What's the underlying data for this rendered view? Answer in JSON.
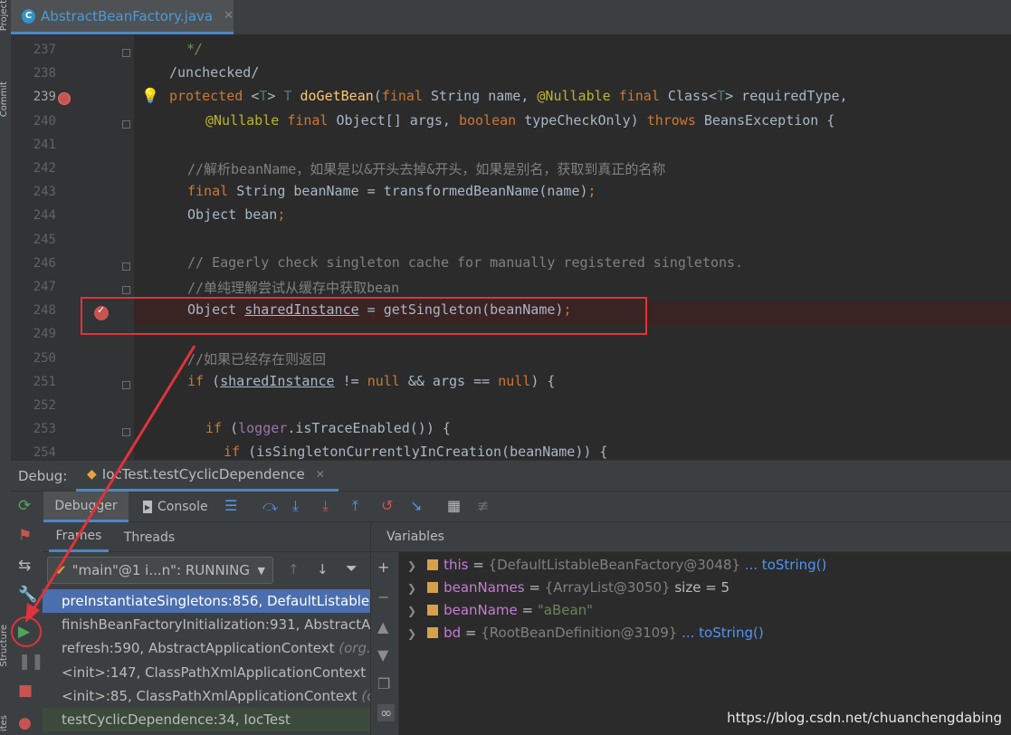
{
  "editor_tab": {
    "icon": "C",
    "file_name": "AbstractBeanFactory.java",
    "close": "✕"
  },
  "left_strip": {
    "labels": [
      "Project",
      "Commit",
      "Structure",
      "ites"
    ]
  },
  "code_lines": [
    {
      "num": "237",
      "segments": [
        {
          "t": " */",
          "c": "doc"
        }
      ],
      "indent": 1
    },
    {
      "num": "238",
      "segments": [
        {
          "t": "/unchecked/",
          "c": "plain"
        }
      ],
      "indent": 0
    },
    {
      "num": "239",
      "segments": [
        {
          "t": "protected ",
          "c": "kw"
        },
        {
          "t": "<",
          "c": "plain"
        },
        {
          "t": "T",
          "c": "tp"
        },
        {
          "t": "> ",
          "c": "plain"
        },
        {
          "t": "T ",
          "c": "tp"
        },
        {
          "t": "doGetBean",
          "c": "fn"
        },
        {
          "t": "(",
          "c": "plain"
        },
        {
          "t": "final ",
          "c": "kw"
        },
        {
          "t": "String name, ",
          "c": "plain"
        },
        {
          "t": "@Nullable ",
          "c": "ann"
        },
        {
          "t": "final ",
          "c": "kw"
        },
        {
          "t": "Class<",
          "c": "plain"
        },
        {
          "t": "T",
          "c": "tp"
        },
        {
          "t": "> requiredType,",
          "c": "plain"
        }
      ],
      "indent": 0
    },
    {
      "num": "240",
      "segments": [
        {
          "t": "@Nullable ",
          "c": "ann"
        },
        {
          "t": "final ",
          "c": "kw"
        },
        {
          "t": "Object[] args, ",
          "c": "plain"
        },
        {
          "t": "boolean ",
          "c": "kw"
        },
        {
          "t": "typeCheckOnly) ",
          "c": "plain"
        },
        {
          "t": "throws ",
          "c": "kw"
        },
        {
          "t": "BeansException {",
          "c": "plain"
        }
      ],
      "indent": 4
    },
    {
      "num": "241",
      "segments": [],
      "indent": 0
    },
    {
      "num": "242",
      "segments": [
        {
          "t": "//解析beanName，如果是以&开头去掉&开头，如果是别名，获取到真正的名称",
          "c": "cm"
        }
      ],
      "indent": 2
    },
    {
      "num": "243",
      "segments": [
        {
          "t": "final ",
          "c": "kw"
        },
        {
          "t": "String beanName = transformedBeanName(name)",
          "c": "plain"
        },
        {
          "t": ";",
          "c": "kw"
        }
      ],
      "indent": 2
    },
    {
      "num": "244",
      "segments": [
        {
          "t": "Object bean",
          "c": "plain"
        },
        {
          "t": ";",
          "c": "kw"
        }
      ],
      "indent": 2
    },
    {
      "num": "245",
      "segments": [],
      "indent": 0
    },
    {
      "num": "246",
      "segments": [
        {
          "t": "// Eagerly check singleton cache for manually registered singletons.",
          "c": "cm"
        }
      ],
      "indent": 2
    },
    {
      "num": "247",
      "segments": [
        {
          "t": "//单纯理解尝试从缓存中获取bean",
          "c": "cm"
        }
      ],
      "indent": 2
    },
    {
      "num": "248",
      "segments": [
        {
          "t": "Object ",
          "c": "plain"
        },
        {
          "t": "sharedInstance",
          "c": "ul"
        },
        {
          "t": " = getSingleton(beanName)",
          "c": "plain"
        },
        {
          "t": ";",
          "c": "kw"
        }
      ],
      "indent": 2
    },
    {
      "num": "249",
      "segments": [],
      "indent": 0
    },
    {
      "num": "250",
      "segments": [
        {
          "t": "//如果已经存在则返回",
          "c": "cm"
        }
      ],
      "indent": 2
    },
    {
      "num": "251",
      "segments": [
        {
          "t": "if ",
          "c": "kw"
        },
        {
          "t": "(",
          "c": "plain"
        },
        {
          "t": "sharedInstance",
          "c": "ul"
        },
        {
          "t": " != ",
          "c": "plain"
        },
        {
          "t": "null ",
          "c": "kw"
        },
        {
          "t": "&& args == ",
          "c": "plain"
        },
        {
          "t": "null",
          "c": "kw"
        },
        {
          "t": ") {",
          "c": "plain"
        }
      ],
      "indent": 2
    },
    {
      "num": "252",
      "segments": [],
      "indent": 0
    },
    {
      "num": "253",
      "segments": [
        {
          "t": "if ",
          "c": "kw"
        },
        {
          "t": "(",
          "c": "plain"
        },
        {
          "t": "logger",
          "c": "fld"
        },
        {
          "t": ".isTraceEnabled()) {",
          "c": "plain"
        }
      ],
      "indent": 4
    },
    {
      "num": "254",
      "segments": [
        {
          "t": "if ",
          "c": "kw"
        },
        {
          "t": "(isSingletonCurrentlyInCreation(beanName)) {",
          "c": "plain"
        }
      ],
      "indent": 6
    }
  ],
  "debug": {
    "label": "Debug:",
    "session": "IocTest.testCyclicDependence",
    "session_close": "✕",
    "tabs": {
      "debugger": "Debugger",
      "console": "Console"
    },
    "frames_tab": "Frames",
    "threads_tab": "Threads",
    "thread_selector": "\"main\"@1 i...n\": RUNNING",
    "variables_header": "Variables"
  },
  "frames": [
    {
      "method": "preInstantiateSingletons:856, DefaultListableBe",
      "pkg": "",
      "style": "sel"
    },
    {
      "method": "finishBeanFactoryInitialization:931, AbstractApp",
      "pkg": "",
      "style": ""
    },
    {
      "method": "refresh:590, AbstractApplicationContext ",
      "pkg": "(org.s",
      "style": ""
    },
    {
      "method": "<init>:147, ClassPathXmlApplicationContext ",
      "pkg": "(o",
      "style": ""
    },
    {
      "method": "<init>:85, ClassPathXmlApplicationContext ",
      "pkg": "(org",
      "style": ""
    },
    {
      "method": "testCyclicDependence:34, IocTest",
      "pkg": "",
      "style": "lib"
    }
  ],
  "variables": [
    {
      "name": "this",
      "eq": " = ",
      "value": "{DefaultListableBeanFactory@3048}",
      "link": " ... toString()",
      "extra": "",
      "kind": "obj"
    },
    {
      "name": "beanNames",
      "eq": " = ",
      "value": "{ArrayList@3050}",
      "link": "",
      "extra": "  size = 5",
      "kind": "obj"
    },
    {
      "name": "beanName",
      "eq": " = ",
      "value": "\"aBean\"",
      "link": "",
      "extra": "",
      "kind": "str"
    },
    {
      "name": "bd",
      "eq": " = ",
      "value": "{RootBeanDefinition@3109}",
      "link": " ... toString()",
      "extra": "",
      "kind": "obj"
    }
  ],
  "watermark": "https://blog.csdn.net/chuanchengdabing",
  "colors": {
    "accent": "#4a88c7",
    "annotation_red": "#e0333b",
    "breakpoint": "#c75450"
  }
}
